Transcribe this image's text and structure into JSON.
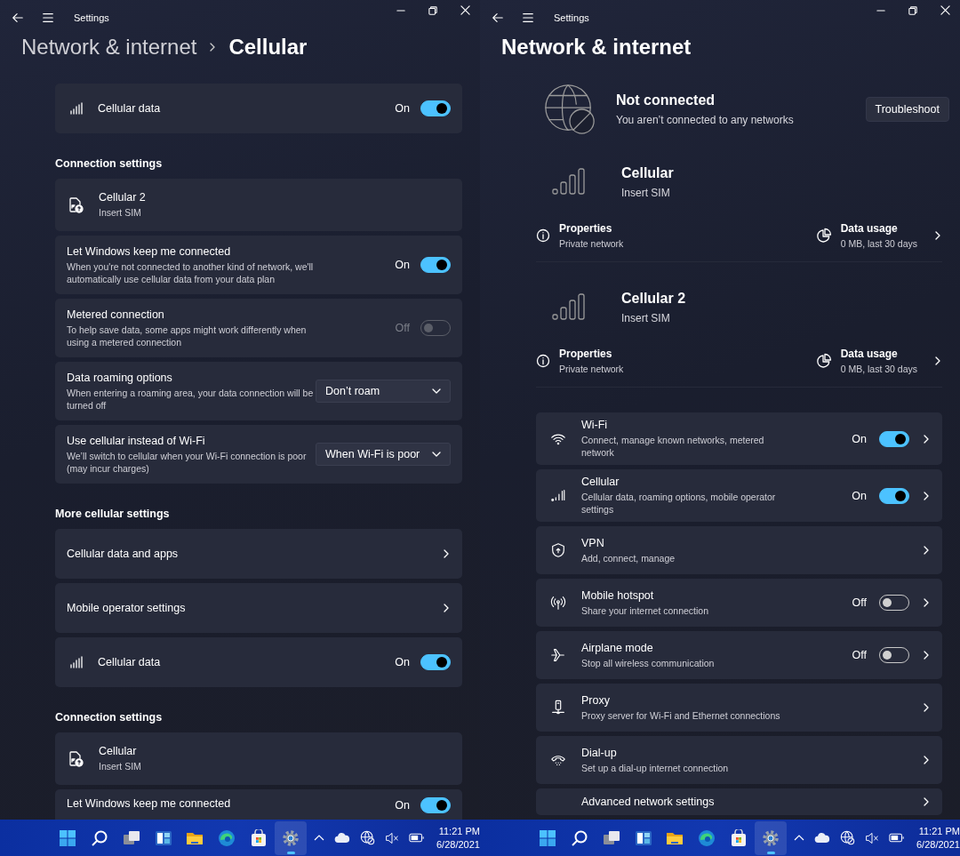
{
  "windows": [
    {
      "title": "Settings",
      "breadcrumb": [
        "Network & internet",
        "Cellular"
      ],
      "items": [
        {
          "kind": "cellular",
          "title": "Cellular data",
          "toggle": {
            "on": true,
            "disabled": false,
            "label": "On"
          }
        },
        {
          "kind": "heading",
          "title": "Connection settings"
        },
        {
          "kind": "sim",
          "title": "Cellular 2",
          "description": "Insert SIM"
        },
        {
          "kind": "toggle",
          "title": "Let Windows keep me connected",
          "description": "When you're not connected to another kind of network, we'll automatically use cellular data from your data plan",
          "toggle": {
            "on": true,
            "disabled": false,
            "label": "On"
          }
        },
        {
          "kind": "toggle",
          "title": "Metered connection",
          "description": "To help save data, some apps might work differently when using a metered connection",
          "toggle": {
            "on": false,
            "disabled": true,
            "label": "Off"
          }
        },
        {
          "kind": "dropdown",
          "title": "Data roaming options",
          "description": "When entering a roaming area, your data connection will be turned off",
          "value": "Don’t roam"
        },
        {
          "kind": "dropdown",
          "title": "Use cellular instead of Wi-Fi",
          "description": "We’ll switch to cellular when your Wi-Fi connection is poor (may incur charges)",
          "value": "When Wi-Fi is poor"
        },
        {
          "kind": "heading",
          "title": "More cellular settings"
        },
        {
          "kind": "link",
          "title": "Cellular data and apps"
        },
        {
          "kind": "link",
          "title": "Mobile operator settings"
        },
        {
          "kind": "cellular",
          "title": "Cellular data",
          "toggle": {
            "on": true,
            "disabled": false,
            "label": "On"
          }
        },
        {
          "kind": "heading",
          "title": "Connection settings"
        },
        {
          "kind": "sim",
          "title": "Cellular",
          "description": "Insert SIM"
        },
        {
          "kind": "toggle",
          "title": "Let Windows keep me connected",
          "toggle": {
            "on": true,
            "disabled": false,
            "label": "On"
          }
        }
      ],
      "taskbar": {
        "apps": [
          {
            "selected": false
          },
          {
            "selected": false
          },
          {
            "selected": false
          },
          {
            "selected": false
          },
          {
            "selected": false
          },
          {
            "selected": false
          },
          {
            "selected": false
          },
          {
            "selected": true
          }
        ],
        "time": "11:21 PM",
        "date": "6/28/2021"
      }
    },
    {
      "title": "Settings",
      "breadcrumb": [
        "Network & internet"
      ],
      "status": {
        "title": "Not connected",
        "description": "You aren’t connected to any networks",
        "button": "Troubleshoot"
      },
      "networks": [
        {
          "name": "Cellular",
          "status": "Insert SIM",
          "properties": {
            "title": "Properties",
            "value": "Private network"
          },
          "usage": {
            "title": "Data usage",
            "value": "0 MB, last 30 days"
          }
        },
        {
          "name": "Cellular 2",
          "status": "Insert SIM",
          "properties": {
            "title": "Properties",
            "value": "Private network"
          },
          "usage": {
            "title": "Data usage",
            "value": "0 MB, last 30 days"
          }
        }
      ],
      "rows": [
        {
          "title": "Wi-Fi",
          "description": "Connect, manage known networks, metered network",
          "toggle": {
            "on": true,
            "label": "On"
          }
        },
        {
          "title": "Cellular",
          "description": "Cellular data, roaming options, mobile operator settings",
          "toggle": {
            "on": true,
            "label": "On"
          }
        },
        {
          "title": "VPN",
          "description": "Add, connect, manage"
        },
        {
          "title": "Mobile hotspot",
          "description": "Share your internet connection",
          "toggle": {
            "on": false,
            "label": "Off"
          }
        },
        {
          "title": "Airplane mode",
          "description": "Stop all wireless communication",
          "toggle": {
            "on": false,
            "label": "Off"
          }
        },
        {
          "title": "Proxy",
          "description": "Proxy server for Wi-Fi and Ethernet connections"
        },
        {
          "title": "Dial-up",
          "description": "Set up a dial-up internet connection"
        },
        {
          "title": "Advanced network settings"
        }
      ],
      "taskbar": {
        "apps": [
          {
            "selected": false
          },
          {
            "selected": false
          },
          {
            "selected": false
          },
          {
            "selected": false
          },
          {
            "selected": false
          },
          {
            "selected": false
          },
          {
            "selected": false
          },
          {
            "selected": true
          }
        ],
        "time": "11:21 PM",
        "date": "6/28/2021"
      }
    }
  ]
}
